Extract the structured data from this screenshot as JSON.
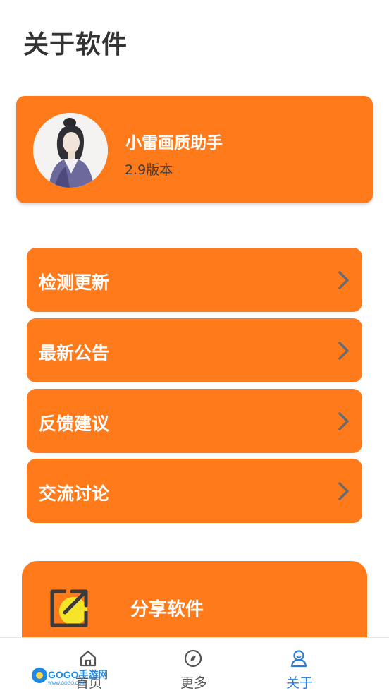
{
  "header": {
    "title": "关于软件"
  },
  "app_info": {
    "name": "小雷画质助手",
    "version": "2.9版本"
  },
  "menu": {
    "items": [
      {
        "label": "检测更新"
      },
      {
        "label": "最新公告"
      },
      {
        "label": "反馈建议"
      },
      {
        "label": "交流讨论"
      }
    ]
  },
  "share": {
    "label": "分享软件"
  },
  "tabbar": {
    "tabs": [
      {
        "label": "首页",
        "icon": "home-icon"
      },
      {
        "label": "更多",
        "icon": "compass-icon"
      },
      {
        "label": "关于",
        "icon": "user-icon",
        "active": true
      }
    ]
  },
  "watermark": {
    "text": "GOGO手游网",
    "sub": "WWW.GOGO.COM"
  },
  "colors": {
    "accent": "#ff7a1a",
    "active_tab": "#2b7bd6",
    "title": "#333333"
  }
}
